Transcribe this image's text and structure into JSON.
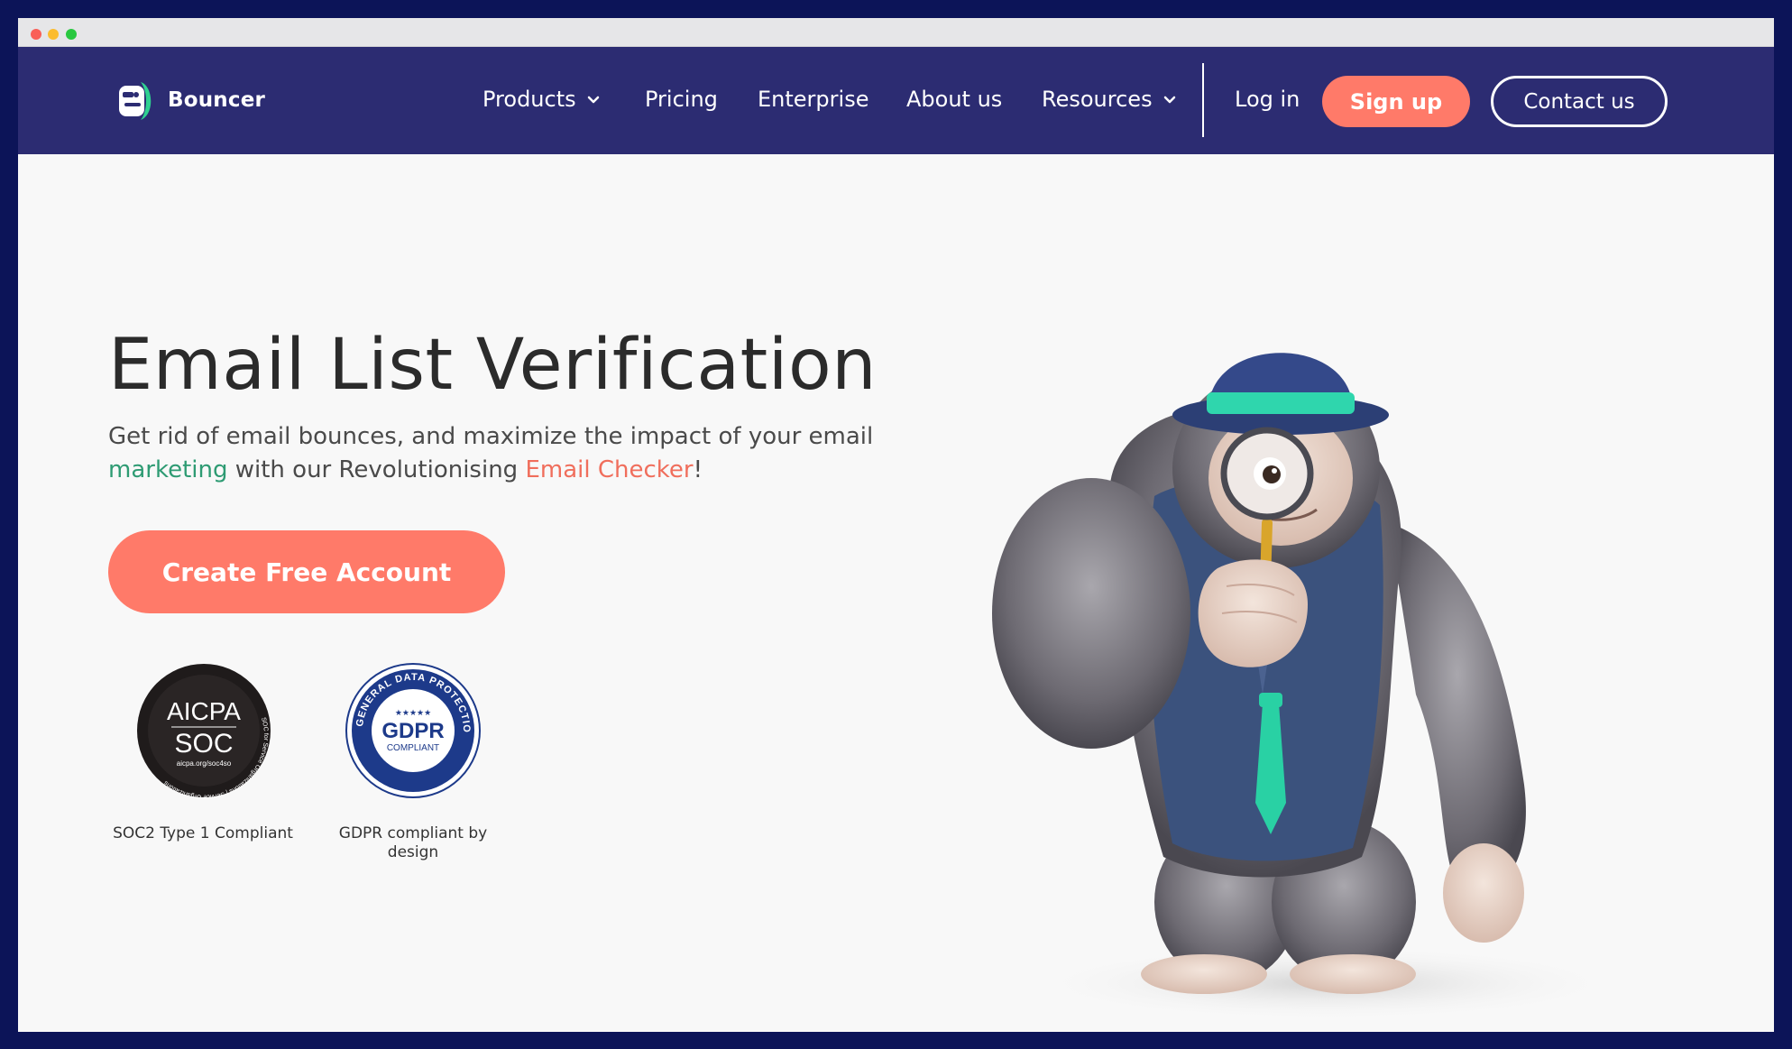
{
  "window": {
    "controls": [
      "close",
      "minimize",
      "maximize"
    ]
  },
  "nav": {
    "brand": "Bouncer",
    "items": [
      {
        "label": "Products",
        "has_dropdown": true
      },
      {
        "label": "Pricing",
        "has_dropdown": false
      },
      {
        "label": "Enterprise",
        "has_dropdown": false
      },
      {
        "label": "About us",
        "has_dropdown": false
      },
      {
        "label": "Resources",
        "has_dropdown": true
      }
    ],
    "login_label": "Log in",
    "signup_label": "Sign up",
    "contact_label": "Contact us"
  },
  "hero": {
    "title": "Email List Verification",
    "subtitle_part1": "Get rid of email bounces, and maximize the impact of your email ",
    "subtitle_highlight1": "marketing",
    "subtitle_part2": " with our Revolutionising ",
    "subtitle_highlight2": "Email Checker",
    "subtitle_part3": "!",
    "cta_label": "Create Free Account"
  },
  "badges": [
    {
      "name": "aicpa-soc",
      "line1": "AICPA",
      "line2": "SOC",
      "url_text": "aicpa.org/soc4so",
      "ring_text": "SOC for Service Organizations | Service Organizations",
      "caption": "SOC2 Type 1 Compliant"
    },
    {
      "name": "gdpr",
      "ring_text": "GENERAL DATA PROTECTION REGULATION",
      "stars": "★★★★★",
      "main": "GDPR",
      "sub": "COMPLIANT",
      "caption": "GDPR compliant by design"
    }
  ],
  "colors": {
    "nav_bg": "#2c2c72",
    "accent_coral": "#ff7a69",
    "highlight_green": "#2e9b73",
    "page_bg": "#f8f8f8",
    "outer_bg": "#0c1458"
  }
}
